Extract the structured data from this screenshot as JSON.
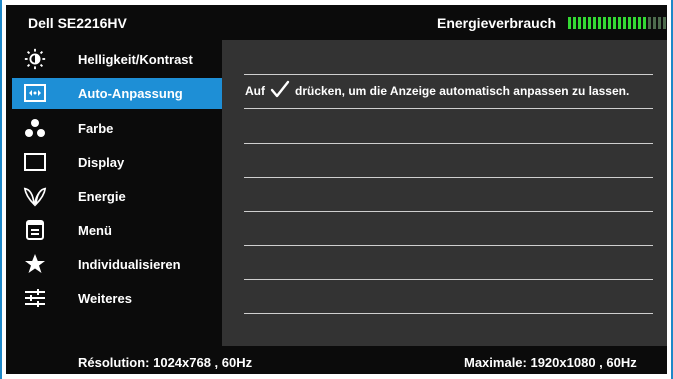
{
  "monitor": {
    "model": "Dell SE2216HV",
    "energy_label": "Energieverbrauch",
    "energy_level": 0.8,
    "energy_color_on": "#34d934",
    "energy_color_off": "#4d6b4d"
  },
  "menu": {
    "items": [
      {
        "label": "Helligkeit/Kontrast",
        "icon": "brightness-icon"
      },
      {
        "label": "Auto-Anpassung",
        "icon": "auto-adjust-icon",
        "active": true
      },
      {
        "label": "Farbe",
        "icon": "color-icon"
      },
      {
        "label": "Display",
        "icon": "display-icon"
      },
      {
        "label": "Energie",
        "icon": "energy-leaf-icon"
      },
      {
        "label": "Menü",
        "icon": "menu-icon"
      },
      {
        "label": "Individualisieren",
        "icon": "star-icon"
      },
      {
        "label": "Weiteres",
        "icon": "sliders-icon"
      }
    ]
  },
  "content": {
    "auto_prefix": "Auf",
    "auto_suffix": "drücken, um die Anzeige automatisch anpassen zu lassen.",
    "check_icon": "checkmark-icon"
  },
  "footer": {
    "resolution": "Résolution: 1024x768 , 60Hz",
    "maximal": "Maximale: 1920x1080 , 60Hz"
  },
  "colors": {
    "accent": "#1e8fd6",
    "background": "#0b0b0b",
    "panel": "#333333"
  }
}
